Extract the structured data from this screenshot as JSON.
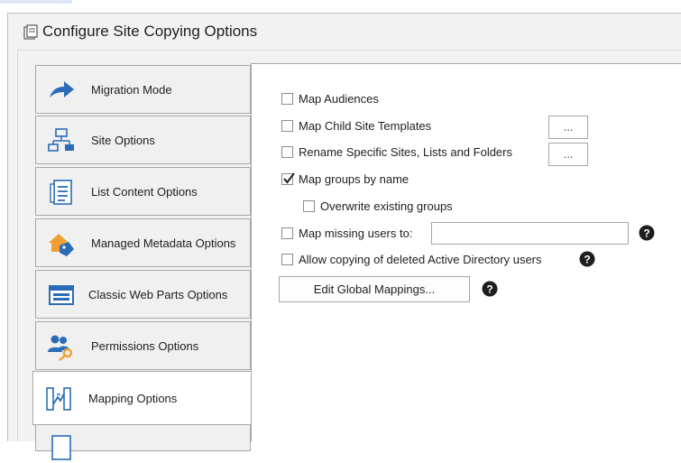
{
  "window": {
    "title": "Configure Site Copying Options"
  },
  "tabs": [
    {
      "label": "Migration Mode",
      "icon": "arrow-icon"
    },
    {
      "label": "Site Options",
      "icon": "sitemap-icon"
    },
    {
      "label": "List Content Options",
      "icon": "list-icon"
    },
    {
      "label": "Managed Metadata Options",
      "icon": "tag-house-icon"
    },
    {
      "label": "Classic Web Parts Options",
      "icon": "webpart-icon"
    },
    {
      "label": "Permissions Options",
      "icon": "users-key-icon"
    },
    {
      "label": "Mapping Options",
      "icon": "mapping-icon",
      "active": true
    }
  ],
  "options": {
    "map_audiences": {
      "label": "Map Audiences",
      "checked": false
    },
    "map_child_site_templates": {
      "label": "Map Child Site Templates",
      "checked": false,
      "browse": "..."
    },
    "rename_specific": {
      "label": "Rename Specific Sites, Lists and Folders",
      "checked": false,
      "browse": "..."
    },
    "map_groups_by_name": {
      "label": "Map groups by name",
      "checked": true
    },
    "overwrite_existing_groups": {
      "label": "Overwrite existing groups",
      "checked": false
    },
    "map_missing_users": {
      "label": "Map missing users to:",
      "checked": false,
      "value": ""
    },
    "allow_deleted_ad_users": {
      "label": "Allow copying of deleted Active Directory users",
      "checked": false
    }
  },
  "buttons": {
    "edit_global_mappings": "Edit Global Mappings..."
  },
  "colors": {
    "accent_blue": "#2b6cb8",
    "help_icon": "#1e1e1e",
    "tab_border": "#a8a8a8"
  }
}
